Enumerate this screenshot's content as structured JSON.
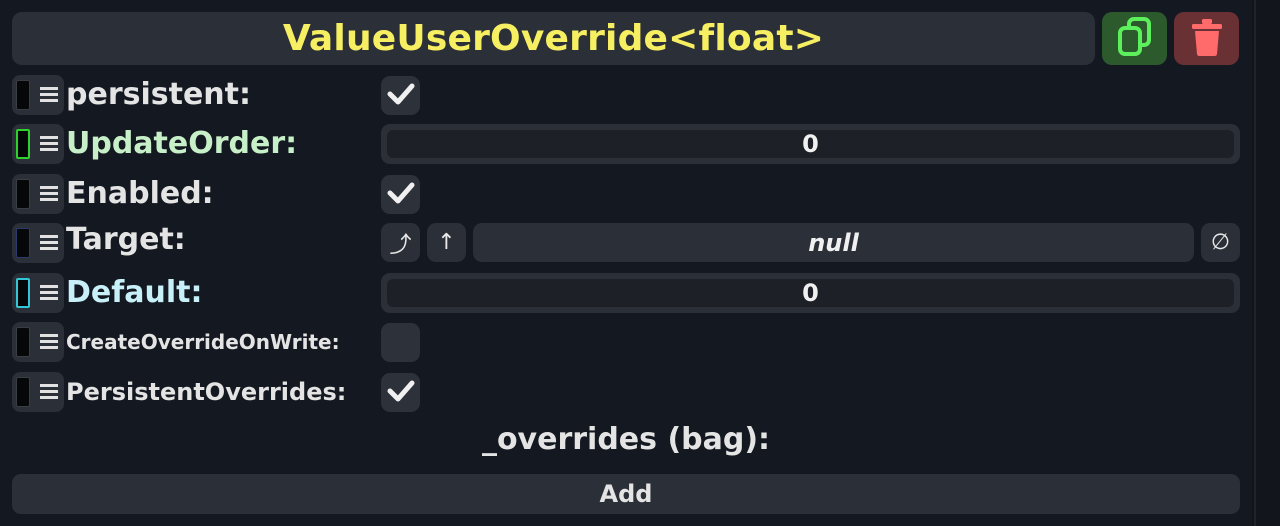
{
  "header": {
    "title": "ValueUserOverride<float>",
    "duplicate_icon": "duplicate-icon",
    "delete_icon": "trash-icon"
  },
  "colors": {
    "title": "#f7ef62",
    "duplicate_bg": "#2d5a2d",
    "duplicate_fg": "#5df05d",
    "delete_bg": "#6a3135",
    "delete_fg": "#ff6b6b",
    "update_order_label": "#c8f0c8",
    "default_label": "#c8f0f8"
  },
  "fields": {
    "persistent": {
      "label": "persistent:",
      "checked": true
    },
    "update_order": {
      "label": "UpdateOrder:",
      "value": "0"
    },
    "enabled": {
      "label": "Enabled:",
      "checked": true
    },
    "target": {
      "label": "Target:",
      "value": "null",
      "jump_icon": "jump-to-icon",
      "up_icon": "arrow-up-icon",
      "clear_icon": "null-clear-icon",
      "jump_glyph": "⤴",
      "up_glyph": "↑",
      "clear_glyph": "∅"
    },
    "default": {
      "label": "Default:",
      "value": "0"
    },
    "create_override_on_write": {
      "label": "CreateOverrideOnWrite:",
      "checked": false
    },
    "persistent_overrides": {
      "label": "PersistentOverrides:",
      "checked": true
    }
  },
  "overrides": {
    "label": "_overrides (bag):",
    "add_label": "Add"
  }
}
